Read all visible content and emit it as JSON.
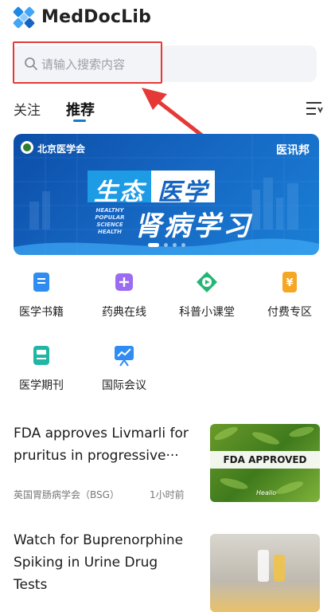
{
  "app": {
    "title": "MedDocLib"
  },
  "search": {
    "placeholder": "请输入搜索内容"
  },
  "tabs": [
    {
      "label": "关注"
    },
    {
      "label": "推荐"
    }
  ],
  "banner": {
    "org": "北京医学会",
    "brand": "医讯邦",
    "line1_a": "生态",
    "line1_b": "医学",
    "line2": "肾病学习",
    "english": [
      "HEALTHY",
      "POPULAR",
      "SCIENCE",
      "HEALTH"
    ]
  },
  "categories": [
    {
      "label": "医学书籍",
      "icon": "book-icon",
      "color": "#2f8cf0"
    },
    {
      "label": "药典在线",
      "icon": "pharmacopoeia-icon",
      "color": "#9b6cf2"
    },
    {
      "label": "科普小课堂",
      "icon": "video-lesson-icon",
      "color": "#22b573"
    },
    {
      "label": "付费专区",
      "icon": "yuan-icon",
      "color": "#f5a623"
    },
    {
      "label": "医学期刊",
      "icon": "journal-icon",
      "color": "#1fb6a6"
    },
    {
      "label": "国际会议",
      "icon": "conference-icon",
      "color": "#2f8cf0"
    }
  ],
  "articles": [
    {
      "title_line1": "FDA approves Livmarli for",
      "title_line2": "pruritus in progressive···",
      "source": "英国胃肠病学会（BSG）",
      "time": "1小时前",
      "thumb_label": "FDA APPROVED",
      "thumb_brand": "Healio"
    },
    {
      "title_line1": "Watch for Buprenorphine",
      "title_line2": "Spiking in Urine Drug Tests"
    }
  ],
  "colors": {
    "accent": "#1976d2",
    "highlight": "#e53935"
  }
}
